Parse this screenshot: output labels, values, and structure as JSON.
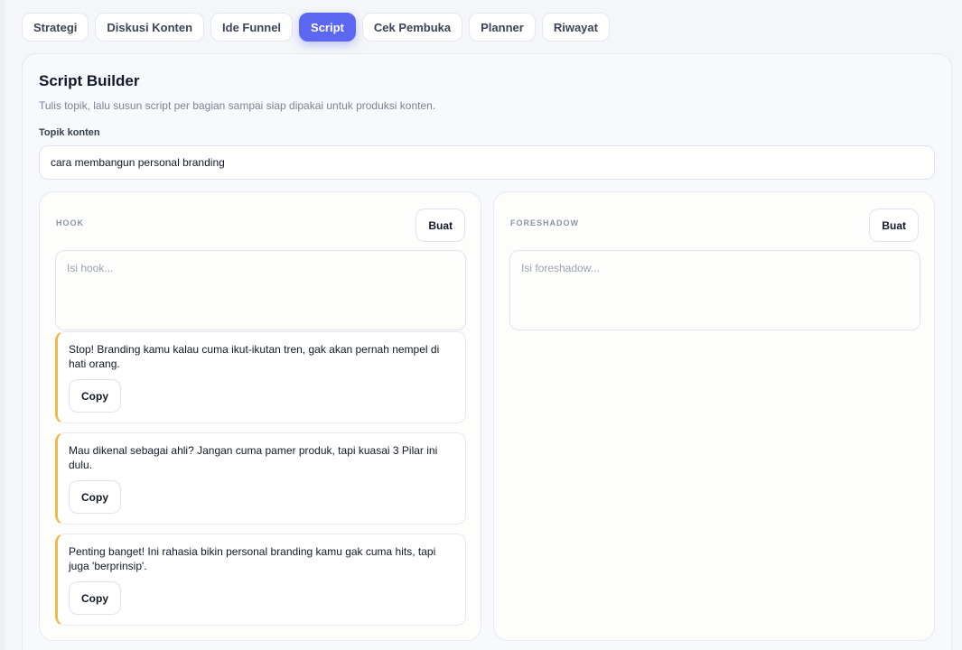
{
  "tabs": [
    {
      "label": "Strategi"
    },
    {
      "label": "Diskusi Konten"
    },
    {
      "label": "Ide Funnel"
    },
    {
      "label": "Script"
    },
    {
      "label": "Cek Pembuka"
    },
    {
      "label": "Planner"
    },
    {
      "label": "Riwayat"
    }
  ],
  "active_tab": "Script",
  "builder": {
    "title": "Script Builder",
    "description": "Tulis topik, lalu susun script per bagian sampai siap dipakai untuk produksi konten.",
    "topic_label": "Topik konten",
    "topic_value": "cara membangun personal branding"
  },
  "hook": {
    "label": "HOOK",
    "generate_label": "Buat",
    "placeholder": "Isi hook...",
    "suggestions": [
      {
        "text": "Stop! Branding kamu kalau cuma ikut-ikutan tren, gak akan pernah nempel di hati orang.",
        "copy_label": "Copy"
      },
      {
        "text": "Mau dikenal sebagai ahli? Jangan cuma pamer produk, tapi kuasai 3 Pilar ini dulu.",
        "copy_label": "Copy"
      },
      {
        "text": "Penting banget! Ini rahasia bikin personal branding kamu gak cuma hits, tapi juga 'berprinsip'.",
        "copy_label": "Copy"
      }
    ]
  },
  "foreshadow": {
    "label": "FORESHADOW",
    "generate_label": "Buat",
    "placeholder": "Isi foreshadow..."
  },
  "colors": {
    "accent": "#5b67f1",
    "suggestion_border": "#f0b948"
  }
}
